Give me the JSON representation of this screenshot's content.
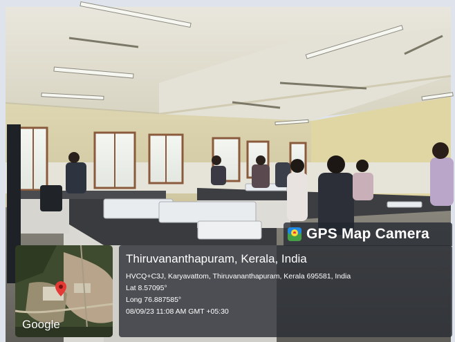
{
  "brand": {
    "name": "GPS Map Camera",
    "icon": "map-pin-app-icon"
  },
  "location": {
    "title": "Thiruvananthapuram, Kerala, India",
    "address": "HVCQ+C3J, Karyavattom, Thiruvananthapuram, Kerala 695581, India",
    "lat": "Lat 8.57095°",
    "long": "Long 76.887585°",
    "datetime": "08/09/23 11:08 AM GMT +05:30"
  },
  "map": {
    "provider": "Google",
    "pin": "location-pin-icon"
  },
  "colors": {
    "panel": "#262a32",
    "pin": "#e53935",
    "accent": "#1e88e5"
  }
}
